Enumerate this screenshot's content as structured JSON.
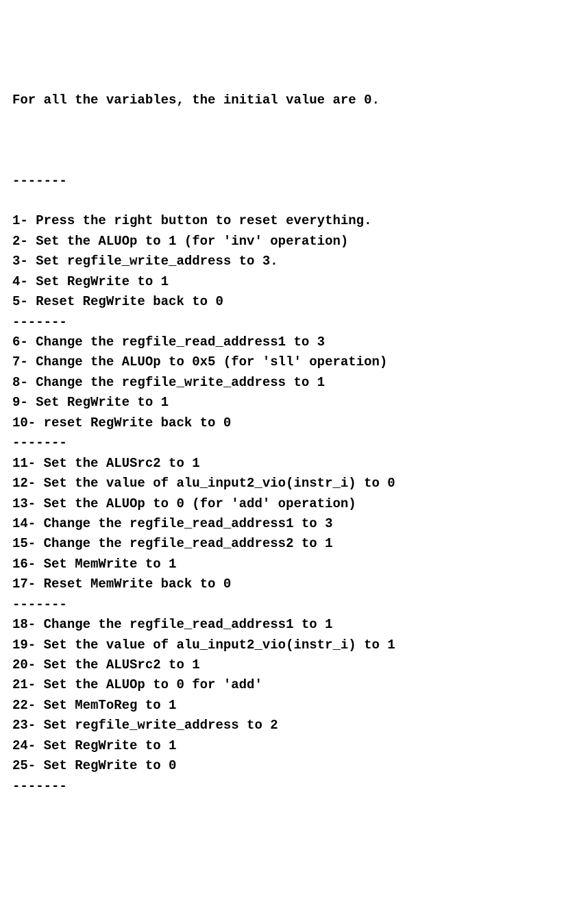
{
  "intro": "For all the variables, the initial value are 0.",
  "divider": "-------",
  "sections": [
    {
      "steps": [
        {
          "n": "1",
          "text": "Press the right button to reset everything."
        },
        {
          "n": "2",
          "text": "Set the ALUOp to 1 (for 'inv' operation)"
        },
        {
          "n": "3",
          "text": "Set regfile_write_address to 3."
        },
        {
          "n": "4",
          "text": "Set RegWrite to 1"
        },
        {
          "n": "5",
          "text": "Reset RegWrite back to 0"
        }
      ]
    },
    {
      "steps": [
        {
          "n": "6",
          "text": "Change the regfile_read_address1 to 3"
        },
        {
          "n": "7",
          "text": "Change the ALUOp to 0x5 (for 'sll' operation)"
        },
        {
          "n": "8",
          "text": "Change the regfile_write_address to 1"
        },
        {
          "n": "9",
          "text": "Set RegWrite to 1"
        },
        {
          "n": "10",
          "text": "reset RegWrite back to 0"
        }
      ]
    },
    {
      "steps": [
        {
          "n": "11",
          "text": "Set the ALUSrc2 to 1"
        },
        {
          "n": "12",
          "text": "Set the value of alu_input2_vio(instr_i) to 0"
        },
        {
          "n": "13",
          "text": "Set the ALUOp to 0 (for 'add' operation)"
        },
        {
          "n": "14",
          "text": "Change the regfile_read_address1 to 3"
        },
        {
          "n": "15",
          "text": "Change the regfile_read_address2 to 1"
        },
        {
          "n": "16",
          "text": "Set MemWrite to 1"
        },
        {
          "n": "17",
          "text": "Reset MemWrite back to 0"
        }
      ]
    },
    {
      "steps": [
        {
          "n": "18",
          "text": "Change the regfile_read_address1 to 1"
        },
        {
          "n": "19",
          "text": "Set the value of alu_input2_vio(instr_i) to 1"
        },
        {
          "n": "20",
          "text": "Set the ALUSrc2 to 1"
        },
        {
          "n": "21",
          "text": "Set the ALUOp to 0 for 'add'"
        },
        {
          "n": "22",
          "text": "Set MemToReg to 1"
        },
        {
          "n": "23",
          "text": "Set regfile_write_address to 2"
        },
        {
          "n": "24",
          "text": "Set RegWrite to 1"
        },
        {
          "n": "25",
          "text": "Set RegWrite to 0"
        }
      ]
    }
  ]
}
